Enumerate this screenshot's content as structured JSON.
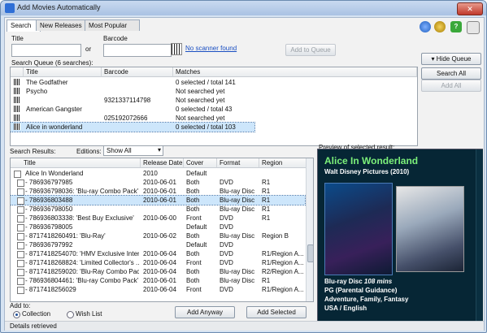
{
  "window": {
    "title": "Add Movies Automatically",
    "close_label": "✕"
  },
  "tabs": [
    {
      "label": "Search"
    },
    {
      "label": "New Releases"
    },
    {
      "label": "Most Popular"
    }
  ],
  "search": {
    "title_label": "Title",
    "or_label": "or",
    "barcode_label": "Barcode",
    "title_value": "",
    "barcode_value": "",
    "no_scanner": "No scanner found",
    "add_to_queue": "Add to Queue"
  },
  "queue": {
    "label": "Search Queue (6 searches):",
    "columns": [
      "Title",
      "Barcode",
      "Matches"
    ],
    "rows": [
      {
        "title": "The Godfather",
        "barcode": "",
        "matches": "0 selected / total 141"
      },
      {
        "title": "Psycho",
        "barcode": "",
        "matches": "Not searched yet"
      },
      {
        "title": "",
        "barcode": "9321337114798",
        "matches": "Not searched yet"
      },
      {
        "title": "American Gangster",
        "barcode": "",
        "matches": "0 selected / total 43"
      },
      {
        "title": "",
        "barcode": "025192072666",
        "matches": "Not searched yet"
      },
      {
        "title": "Alice in wonderland",
        "barcode": "",
        "matches": "0 selected / total 103"
      }
    ],
    "hide_queue": "Hide Queue",
    "search_all": "Search All",
    "add_all": "Add All"
  },
  "results": {
    "label": "Search Results:",
    "editions_label": "Editions:",
    "editions_value": "Show All",
    "columns": [
      "Title",
      "Release Date",
      "Cover",
      "Format",
      "Region"
    ],
    "rows": [
      {
        "title": "Alice In Wonderland",
        "date": "2010",
        "cover": "Default",
        "format": "",
        "region": ""
      },
      {
        "title": "- 786936797985",
        "date": "2010-06-01",
        "cover": "Both",
        "format": "DVD",
        "region": "R1"
      },
      {
        "title": "- 786936798036: 'Blu-ray Combo Pack'",
        "date": "2010-06-01",
        "cover": "Both",
        "format": "Blu-ray Disc",
        "region": "R1"
      },
      {
        "title": "- 786936803488",
        "date": "2010-06-01",
        "cover": "Both",
        "format": "Blu-ray Disc",
        "region": "R1"
      },
      {
        "title": "- 786936798050",
        "date": "",
        "cover": "Both",
        "format": "Blu-ray Disc",
        "region": "R1"
      },
      {
        "title": "- 786936803338: 'Best Buy Exclusive'",
        "date": "2010-06-00",
        "cover": "Front",
        "format": "DVD",
        "region": "R1"
      },
      {
        "title": "- 786936798005",
        "date": "",
        "cover": "Default",
        "format": "DVD",
        "region": ""
      },
      {
        "title": "- 8717418260491: 'Blu-Ray'",
        "date": "2010-06-02",
        "cover": "Both",
        "format": "Blu-ray Disc",
        "region": "Region B"
      },
      {
        "title": "- 786936797992",
        "date": "",
        "cover": "Default",
        "format": "DVD",
        "region": ""
      },
      {
        "title": "- 8717418254070: 'HMV Exclusive Inter...",
        "date": "2010-06-04",
        "cover": "Both",
        "format": "DVD",
        "region": "R1/Region A..."
      },
      {
        "title": "- 8717418268824: 'Limited Collector's ...",
        "date": "2010-06-04",
        "cover": "Front",
        "format": "DVD",
        "region": "R1/Region A..."
      },
      {
        "title": "- 8717418259020: 'Blu-Ray Combo Pack'",
        "date": "2010-06-04",
        "cover": "Both",
        "format": "Blu-ray Disc",
        "region": "R2/Region A..."
      },
      {
        "title": "- 786936804461: 'Blu-ray Combo Pack'",
        "date": "2010-06-01",
        "cover": "Both",
        "format": "Blu-ray Disc",
        "region": "R1"
      },
      {
        "title": "- 8717418256029",
        "date": "2010-06-04",
        "cover": "Front",
        "format": "DVD",
        "region": "R1/Region A..."
      }
    ],
    "selected_index": 3
  },
  "add_to": {
    "label": "Add to:",
    "collection": "Collection",
    "wish_list": "Wish List",
    "selected": "Collection",
    "add_anyway": "Add Anyway",
    "add_selected": "Add Selected"
  },
  "preview": {
    "label": "Preview of selected result:",
    "title": "Alice In Wonderland",
    "studio": "Walt Disney Pictures (2010)",
    "format_line": "Blu-ray Disc",
    "runtime": "108 mins",
    "rating": "PG (Parental Guidance)",
    "genres": "Adventure, Family, Fantasy",
    "language": "USA  /  English"
  },
  "status": {
    "text": "Details retrieved"
  },
  "colors": {
    "preview_bg": "#062635",
    "preview_title": "#7cf07a",
    "selection": "#cde6fb"
  }
}
